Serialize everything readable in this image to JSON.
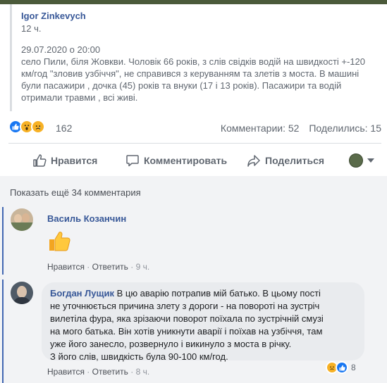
{
  "shared_post": {
    "author": "Igor Zinkevych",
    "time": "12 ч.",
    "date_line": "29.07.2020 о 20:00",
    "body_lines": [
      "село Пили, біля Жовкви. Чоловік 66 років, з слів свідків водій на швидкості +-120",
      "км/год \"зловив узбіччя\", не справився з керуванням та злетів з моста. В машині",
      "були пасажири , дочка (45) років та внуки (17 і 13 років). Пасажири та водій",
      "отримали травми , всі живі."
    ]
  },
  "stats": {
    "reaction_count": "162",
    "comments": "Комментарии: 52",
    "shares": "Поделились: 15"
  },
  "actions": {
    "like": "Нравится",
    "comment": "Комментировать",
    "share": "Поделиться"
  },
  "more_comments": "Показать ещё 34 комментария",
  "comments": [
    {
      "author": "Василь Козанчин",
      "content_icon": "thumbs-up-icon",
      "like": "Нравится",
      "reply": "Ответить",
      "time": "9 ч."
    },
    {
      "author": "Богдан Лущик",
      "text_first": "В цю аварію потрапив мій батько. В цьому пості",
      "text_lines": [
        "не уточнюється причина злету з дороги - на повороті на зустріч",
        "вилетіла фура, яка зрізаючи поворот поїхала по зустрічній смузі",
        "на мого батька. Він хотів уникнути аварії і поїхав на узбіччя, там",
        "уже його занесло, розвернуло і викинуло з моста в річку.",
        "З його слів, швидкість була 90-100 км/год."
      ],
      "like": "Нравится",
      "reply": "Ответить",
      "time": "8 ч.",
      "reaction_count": "8"
    }
  ],
  "colors": {
    "link": "#385898",
    "accent": "#4267b2",
    "muted": "#606770"
  }
}
